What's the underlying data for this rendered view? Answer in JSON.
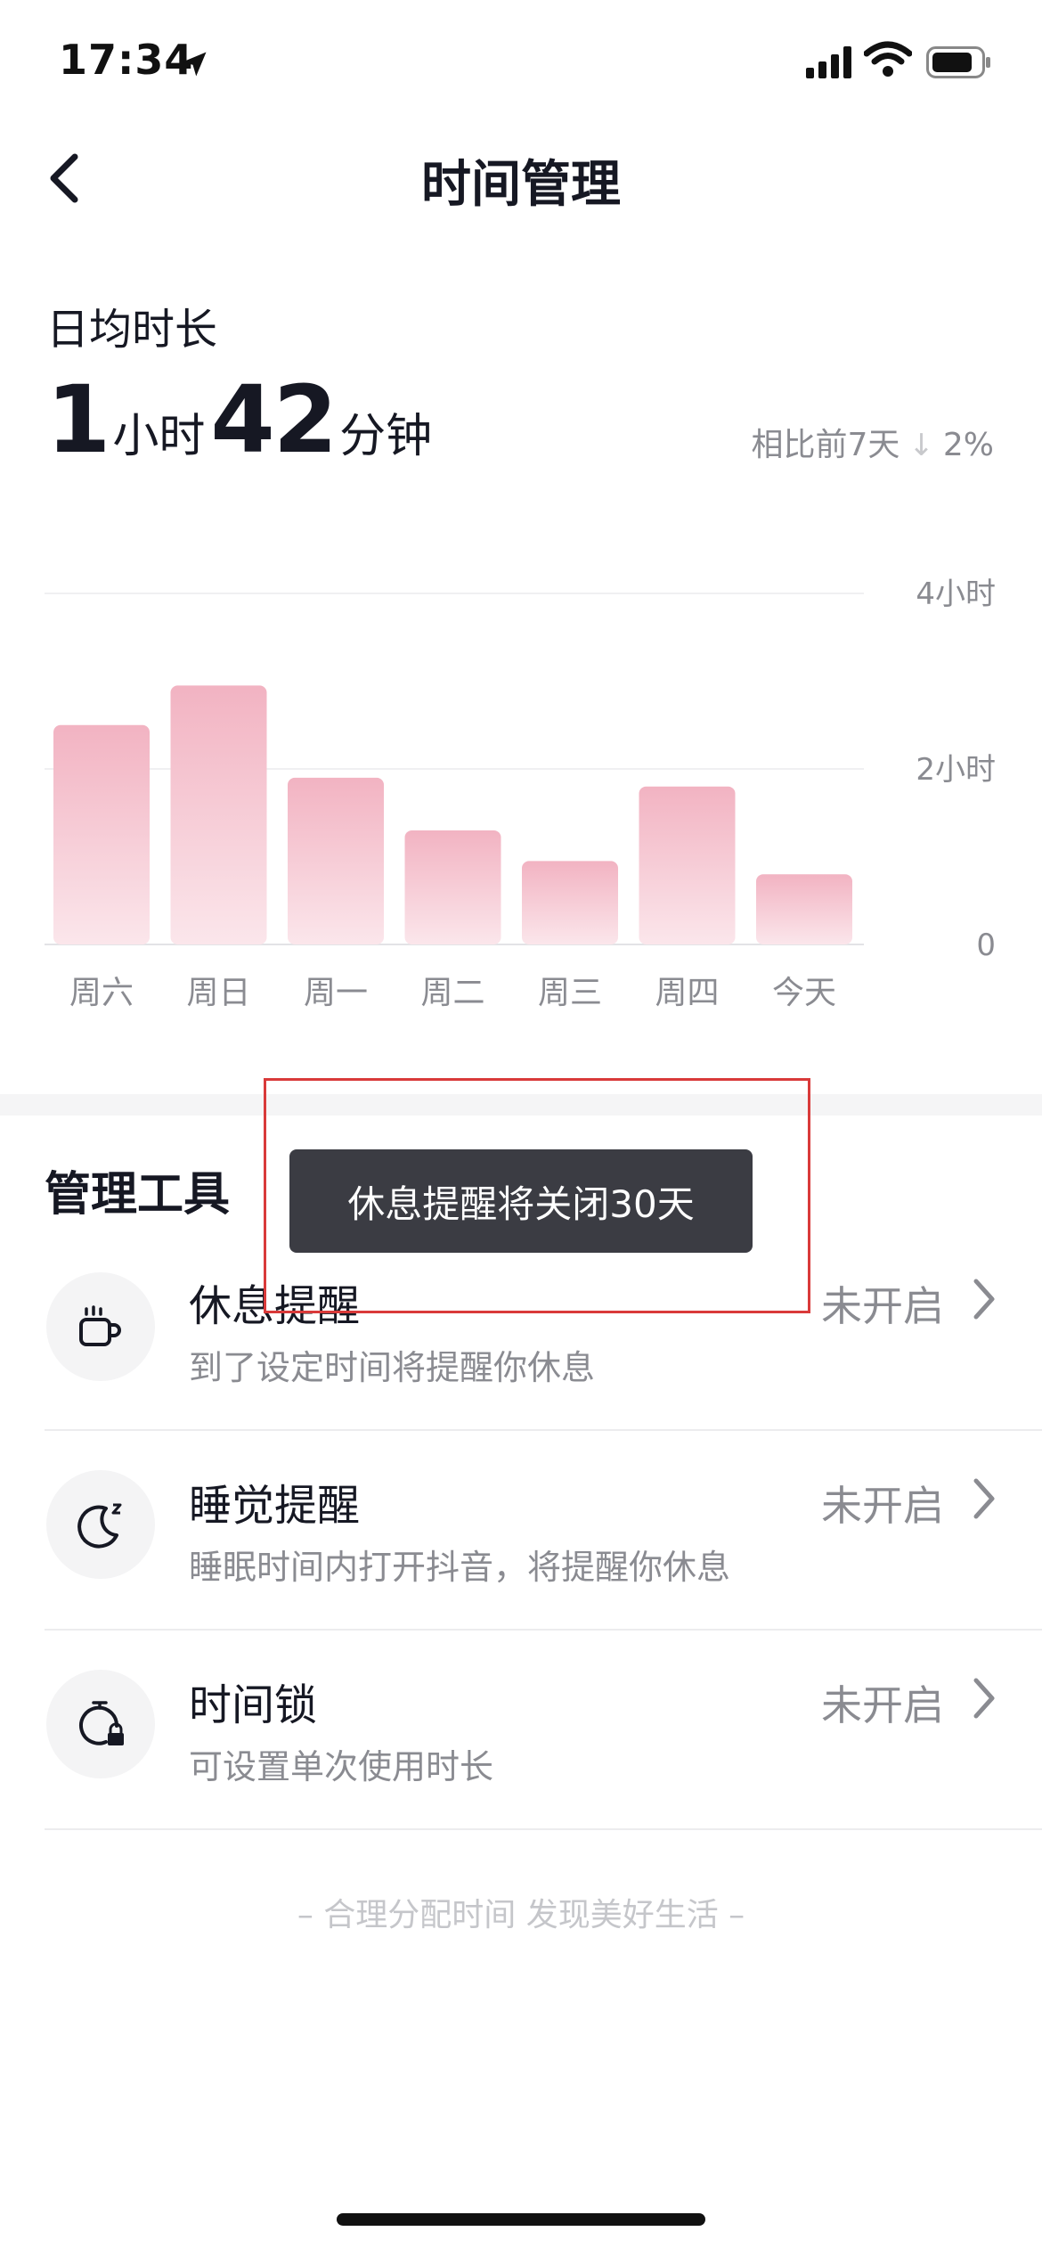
{
  "status_bar": {
    "time": "17:34"
  },
  "header": {
    "title": "时间管理"
  },
  "summary": {
    "label": "日均时长",
    "hours": "1",
    "hours_unit": "小时",
    "minutes": "42",
    "minutes_unit": "分钟",
    "compare_label": "相比前7天",
    "compare_value": "2%",
    "compare_direction": "down"
  },
  "chart_data": {
    "type": "bar",
    "categories": [
      "周六",
      "周日",
      "周一",
      "周二",
      "周三",
      "周四",
      "今天"
    ],
    "values": [
      2.5,
      2.95,
      1.9,
      1.3,
      0.95,
      1.8,
      0.8
    ],
    "y_ticks": [
      "4小时",
      "2小时",
      "0"
    ],
    "ylim": [
      0,
      4
    ],
    "bar_color": "#f4b5c4",
    "grid": true
  },
  "tools": {
    "title": "管理工具",
    "items": [
      {
        "name": "休息提醒",
        "desc": "到了设定时间将提醒你休息",
        "status": "未开启",
        "icon": "cup-icon"
      },
      {
        "name": "睡觉提醒",
        "desc": "睡眠时间内打开抖音，将提醒你休息",
        "status": "未开启",
        "icon": "moon-icon"
      },
      {
        "name": "时间锁",
        "desc": "可设置单次使用时长",
        "status": "未开启",
        "icon": "timer-lock-icon"
      }
    ]
  },
  "slogan": "– 合理分配时间 发现美好生活 –",
  "toast": {
    "text": "休息提醒将关闭30天"
  },
  "colors": {
    "accent": "#f4b5c4",
    "toast_bg": "#3b3c43",
    "highlight_box": "#d93a3a"
  }
}
